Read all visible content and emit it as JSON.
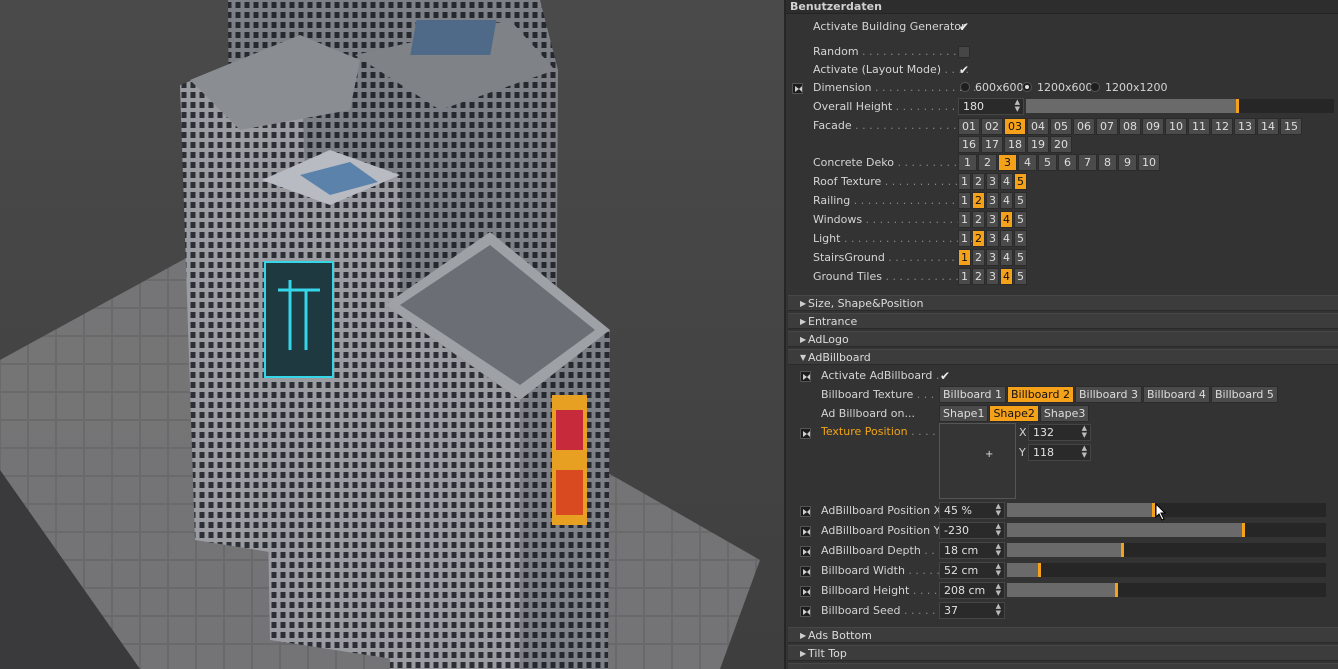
{
  "panel": {
    "title": "Benutzerdaten",
    "rows": {
      "activate_generator": "Activate Building Generator",
      "random": "Random",
      "activate_layout": "Activate (Layout Mode)",
      "dimension": "Dimension",
      "overall_height": "Overall Height",
      "facade": "Facade",
      "concrete_deko": "Concrete Deko",
      "roof_texture": "Roof Texture",
      "railing": "Railing",
      "windows": "Windows",
      "light": "Light",
      "stairs_ground": "StairsGround",
      "ground_tiles": "Ground Tiles"
    },
    "dimension_options": [
      "600x600",
      "1200x600",
      "1200x1200"
    ],
    "dimension_selected": "1200x600",
    "overall_height_value": "180",
    "overall_height_fraction": 0.76,
    "facade_options": [
      "01",
      "02",
      "03",
      "04",
      "05",
      "06",
      "07",
      "08",
      "09",
      "10",
      "11",
      "12",
      "13",
      "14",
      "15",
      "16",
      "17",
      "18",
      "19",
      "20"
    ],
    "facade_selected": "03",
    "concrete_options": [
      "1",
      "2",
      "3",
      "4",
      "5",
      "6",
      "7",
      "8",
      "9",
      "10"
    ],
    "concrete_selected": "3",
    "roof_selected": "5",
    "railing_selected": "2",
    "windows_selected": "4",
    "light_selected": "2",
    "stairs_selected": "1",
    "ground_selected": "4",
    "one_to_five": [
      "1",
      "2",
      "3",
      "4",
      "5"
    ],
    "sections": {
      "size_shape": "Size, Shape&Position",
      "entrance": "Entrance",
      "adlogo": "AdLogo",
      "adbillboard": "AdBillboard",
      "ads_bottom": "Ads Bottom",
      "tilt_top": "Tilt Top"
    },
    "billboard": {
      "activate": "Activate AdBillboard",
      "texture": "Billboard Texture",
      "texture_options": [
        "Billboard 1",
        "Billboard 2",
        "Billboard 3",
        "Billboard 4",
        "Billboard 5"
      ],
      "texture_selected": "Billboard 2",
      "shape_label": "Ad Billboard on...",
      "shape_options": [
        "Shape1",
        "Shape2",
        "Shape3"
      ],
      "shape_selected": "Shape2",
      "texture_position": "Texture Position",
      "x_label": "X",
      "x_value": "132",
      "y_label": "Y",
      "y_value": "118",
      "pos_x": "AdBillboard Position X",
      "pos_x_value": "45 %",
      "pos_x_fraction": 0.45,
      "pos_y": "AdBillboard Position Y",
      "pos_y_value": "-230",
      "pos_y_fraction": 0.74,
      "depth": "AdBillboard Depth",
      "depth_value": "18 cm",
      "depth_fraction": 0.36,
      "width": "Billboard Width",
      "width_value": "52 cm",
      "width_fraction": 0.1,
      "height": "Billboard Height",
      "height_value": "208 cm",
      "height_fraction": 0.34,
      "seed": "Billboard Seed",
      "seed_value": "37"
    }
  },
  "colors": {
    "accent": "#f5a11a",
    "panel_bg": "#333333"
  }
}
